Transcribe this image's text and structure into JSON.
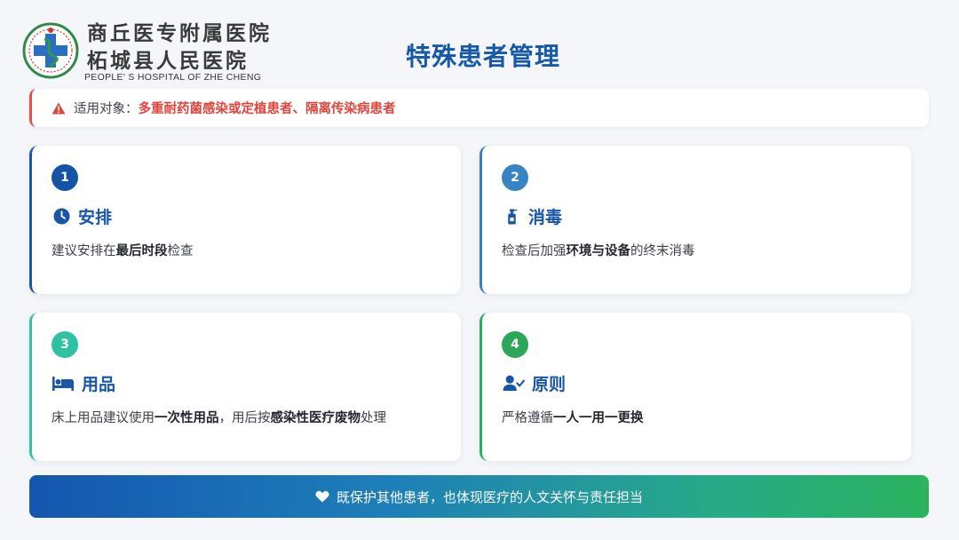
{
  "logo": {
    "name_line1": "商丘医专附属医院",
    "name_line2": "柘城县人民医院",
    "english": "PEOPLE' S HOSPITAL OF ZHE CHENG"
  },
  "title": "特殊患者管理",
  "alert": {
    "icon": "warning-triangle-icon",
    "label": "适用对象：",
    "value": "多重耐药菌感染或定植患者、隔离传染病患者",
    "color": "#e0453c"
  },
  "cards": [
    {
      "number": "1",
      "icon": "clock-icon",
      "title": "安排",
      "desc_pre": "建议安排在",
      "desc_bold1": "最后时段",
      "desc_mid": "检查",
      "desc_bold2": "",
      "desc_post": ""
    },
    {
      "number": "2",
      "icon": "spray-bottle-icon",
      "title": "消毒",
      "desc_pre": "检查后加强",
      "desc_bold1": "环境与设备",
      "desc_mid": "的终末消毒",
      "desc_bold2": "",
      "desc_post": ""
    },
    {
      "number": "3",
      "icon": "bed-icon",
      "title": "用品",
      "desc_pre": "床上用品建议使用",
      "desc_bold1": "一次性用品",
      "desc_mid": "，用后按",
      "desc_bold2": "感染性医疗废物",
      "desc_post": "处理"
    },
    {
      "number": "4",
      "icon": "user-check-icon",
      "title": "原则",
      "desc_pre": "严格遵循",
      "desc_bold1": "一人一用一更换",
      "desc_mid": "",
      "desc_bold2": "",
      "desc_post": ""
    }
  ],
  "banner": {
    "icon": "heart-icon",
    "text": "既保护其他患者，也体现医疗的人文关怀与责任担当"
  },
  "colors": {
    "primary": "#1756a8",
    "card2": "#3784c4",
    "card3": "#2fc1a2",
    "card4": "#2ca75a"
  }
}
